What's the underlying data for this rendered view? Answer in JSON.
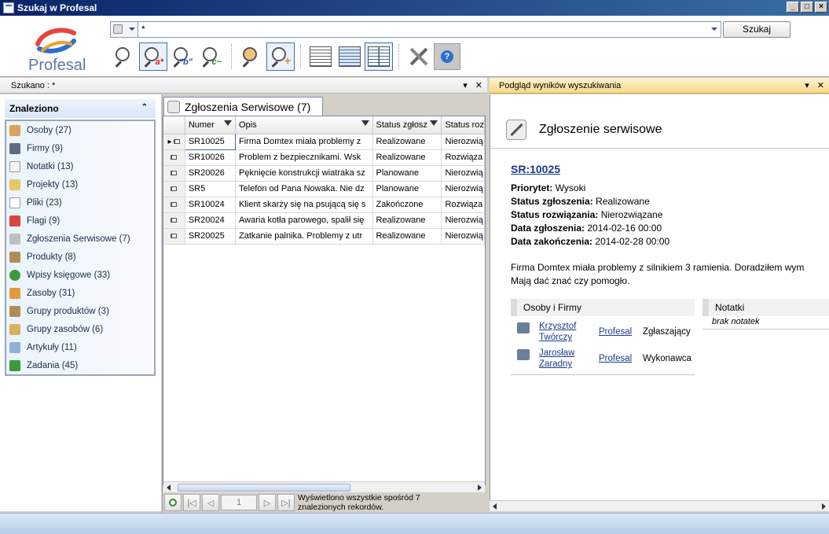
{
  "window": {
    "title": "Szukaj w Profesal"
  },
  "logo": {
    "text": "Profesal"
  },
  "search": {
    "value": "*",
    "button_label": "Szukaj"
  },
  "left_panel": {
    "header": "Szukano : *"
  },
  "found": {
    "title": "Znaleziono",
    "items": [
      {
        "label": "Osoby (27)",
        "icon": "person-icon",
        "color": "#d9a35b"
      },
      {
        "label": "Firmy (9)",
        "icon": "company-icon",
        "color": "#5d6b80"
      },
      {
        "label": "Notatki (13)",
        "icon": "note-icon",
        "color": "#f4f4f4"
      },
      {
        "label": "Projekty (13)",
        "icon": "folder-icon",
        "color": "#e8c864"
      },
      {
        "label": "Pliki (23)",
        "icon": "file-icon",
        "color": "#ffffff"
      },
      {
        "label": "Flagi (9)",
        "icon": "flag-icon",
        "color": "#d9453b"
      },
      {
        "label": "Zgłoszenia Serwisowe (7)",
        "icon": "service-icon",
        "color": "#c0c0c0"
      },
      {
        "label": "Produkty (8)",
        "icon": "product-icon",
        "color": "#b08d57"
      },
      {
        "label": "Wpisy księgowe (33)",
        "icon": "accounting-icon",
        "color": "#3b9a3b"
      },
      {
        "label": "Zasoby (31)",
        "icon": "resource-icon",
        "color": "#e29a3b"
      },
      {
        "label": "Grupy produktów (3)",
        "icon": "product-group-icon",
        "color": "#b08d57"
      },
      {
        "label": "Grupy zasobów (6)",
        "icon": "resource-group-icon",
        "color": "#d9b35b"
      },
      {
        "label": "Artykuły (11)",
        "icon": "article-icon",
        "color": "#8fb0d8"
      },
      {
        "label": "Zadania (45)",
        "icon": "task-icon",
        "color": "#3b9a3b"
      }
    ]
  },
  "results": {
    "tab_label": "Zgłoszenia Serwisowe (7)",
    "columns": [
      "Numer",
      "Opis",
      "Status zgłosz",
      "Status roz"
    ],
    "rows": [
      {
        "num": "SR10025",
        "desc": "Firma Domtex miała problemy z",
        "status": "Realizowane",
        "res": "Nierozwią"
      },
      {
        "num": "SR10026",
        "desc": "Problem z bezpiecznikami.  Wsk",
        "status": "Realizowane",
        "res": "Rozwiąza"
      },
      {
        "num": "SR20026",
        "desc": "Pęknięcie konstrukcji wiatraka sz",
        "status": "Planowane",
        "res": "Nierozwią"
      },
      {
        "num": "SR5",
        "desc": "Telefon od Pana Nowaka. Nie dz",
        "status": "Planowane",
        "res": "Nierozwią"
      },
      {
        "num": "SR10024",
        "desc": "Klient skarży się na psującą się s",
        "status": "Zakończone",
        "res": "Rozwiąza"
      },
      {
        "num": "SR20024",
        "desc": "Awaria kotła parowego, spalił się",
        "status": "Realizowane",
        "res": "Nierozwią"
      },
      {
        "num": "SR20025",
        "desc": "Zatkanie palnika. Problemy z utr",
        "status": "Realizowane",
        "res": "Nierozwią"
      }
    ],
    "pager": {
      "page": "1",
      "status": "Wyświetlono wszystkie spośród 7 znalezionych rekordów."
    }
  },
  "preview": {
    "header": "Podgląd wyników wyszukiwania",
    "title": "Zgłoszenie serwisowe",
    "id": "SR:10025",
    "fields": [
      {
        "label": "Priorytet:",
        "value": "Wysoki"
      },
      {
        "label": "Status zgłoszenia:",
        "value": "Realizowane"
      },
      {
        "label": "Status rozwiązania:",
        "value": "Nierozwiązane"
      },
      {
        "label": "Data zgłoszenia:",
        "value": "2014-02-16 00:00"
      },
      {
        "label": "Data zakończenia:",
        "value": "2014-02-28 00:00"
      }
    ],
    "description_line1": "Firma Domtex miała problemy z silnikiem 3 ramienia. Doradziłem wym",
    "description_line2": "Mają dać znać czy pomogło.",
    "people_header": "Osoby i Firmy",
    "notes_header": "Notatki",
    "notes_empty": "brak notatek",
    "people": [
      {
        "first": "Krzysztof",
        "last": "Twórczy",
        "company": "Profesal",
        "role": "Zgłaszający"
      },
      {
        "first": "Jarosław",
        "last": "Zaradny",
        "company": "Profesal",
        "role": "Wykonawca"
      }
    ]
  }
}
